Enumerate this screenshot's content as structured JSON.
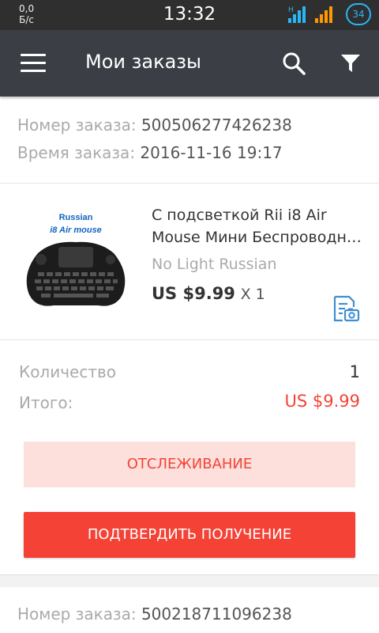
{
  "statusbar": {
    "net_speed_value": "0,0",
    "net_speed_unit": "Б/с",
    "time": "13:32",
    "battery": "34"
  },
  "appbar": {
    "title": "Мои заказы"
  },
  "orders": [
    {
      "number_label": "Номер заказа:",
      "number_value": "500506277426238",
      "time_label": "Время заказа:",
      "time_value": "2016-11-16 19:17",
      "item": {
        "image_text_1": "Russian",
        "image_text_2": "i8 Air mouse",
        "title_line1": "С подсветкой Rii i8 Air",
        "title_line2": "Mouse Мини Беспроводна...",
        "variant": "No Light Russian",
        "price": "US $9.99",
        "qty": "X 1"
      },
      "quantity_label": "Количество",
      "quantity_value": "1",
      "total_label": "Итого:",
      "total_value": "US $9.99",
      "track_button": "ОТСЛЕЖИВАНИЕ",
      "confirm_button": "ПОДТВЕРДИТЬ ПОЛУЧЕНИЕ"
    },
    {
      "number_label": "Номер заказа:",
      "number_value": "500218711096238"
    }
  ],
  "colors": {
    "accent_red": "#f44336",
    "track_bg": "#fde0dc",
    "appbar": "#3b3f45",
    "icon_blue": "#3f8fd0"
  },
  "icons": {
    "menu": "hamburger-icon",
    "search": "search-icon",
    "filter": "filter-icon",
    "document": "document-photo-icon"
  }
}
